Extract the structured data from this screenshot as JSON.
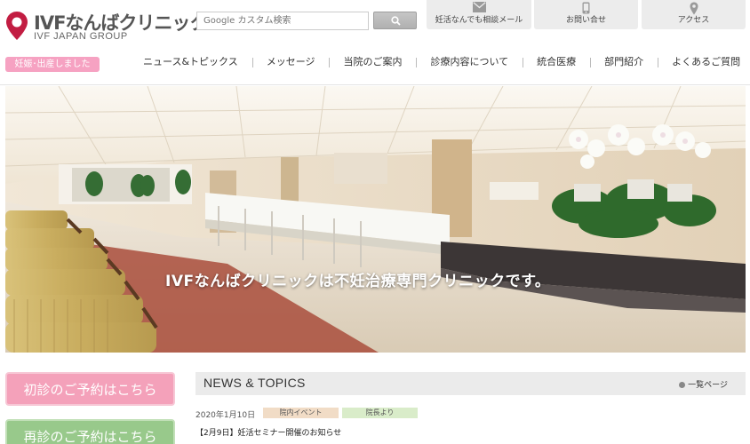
{
  "header": {
    "logo_name": "IVFなんばクリニック",
    "logo_sub": "IVF JAPAN GROUP",
    "search": {
      "placeholder": "Google カスタム検索"
    },
    "top_links": [
      {
        "label": "妊活なんでも相談メール",
        "icon": "envelope-icon"
      },
      {
        "label": "お問い合せ",
        "icon": "phone-icon"
      },
      {
        "label": "アクセス",
        "icon": "map-pin-icon"
      }
    ],
    "pregnancy_tag": "妊娠･出産しました"
  },
  "nav": {
    "items": [
      "ニュース&トピックス",
      "メッセージ",
      "当院のご案内",
      "診療内容について",
      "統合医療",
      "部門紹介",
      "よくあるご質問"
    ]
  },
  "hero": {
    "caption": "IVFなんばクリニックは不妊治療専門クリニックです。"
  },
  "reservations": {
    "first_visit": "初診のご予約はこちら",
    "return_visit": "再診のご予約はこちら"
  },
  "news": {
    "title": "NEWS & TOPICS",
    "more_label": "一覧ページ",
    "items": [
      {
        "date": "2020年1月10日",
        "tags": [
          "院内イベント",
          "院長より"
        ],
        "headline": "【2月9日】妊活セミナー開催のお知らせ"
      }
    ]
  },
  "colors": {
    "brand_red": "#c21d42",
    "pink": "#f4a1ba",
    "green": "#98c98b"
  }
}
